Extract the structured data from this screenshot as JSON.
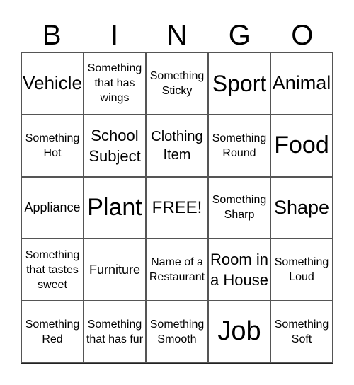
{
  "header": [
    "B",
    "I",
    "N",
    "G",
    "O"
  ],
  "cells": [
    "Vehicle",
    "Something that has wings",
    "Something Sticky",
    "Sport",
    "Animal",
    "Something Hot",
    "School Subject",
    "Clothing Item",
    "Something Round",
    "Food",
    "Appliance",
    "Plant",
    "FREE!",
    "Something Sharp",
    "Shape",
    "Something that tastes sweet",
    "Furniture",
    "Name of a Restaurant",
    "Room in a House",
    "Something Loud",
    "Something Red",
    "Something that has fur",
    "Something Smooth",
    "Job",
    "Something Soft"
  ]
}
